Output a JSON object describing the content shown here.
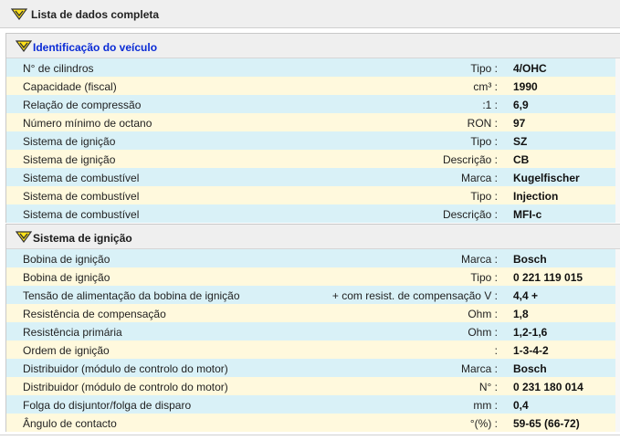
{
  "header": {
    "title": "Lista de dados completa",
    "icon": "chevron-down-icon"
  },
  "colors": {
    "row_alt_a": "#d9f1f7",
    "row_alt_b": "#fff9dd",
    "section_title_blue": "#0a2bd6",
    "icon_yellow": "#ffe21a"
  },
  "sections": [
    {
      "title": "Identificação do veículo",
      "rows": [
        {
          "label": "N° de cilindros",
          "unit": "Tipo :",
          "value": "4/OHC"
        },
        {
          "label": "Capacidade (fiscal)",
          "unit": "cm³ :",
          "value": "1990"
        },
        {
          "label": "Relação de compressão",
          "unit": ":1 :",
          "value": "6,9"
        },
        {
          "label": "Número mínimo de octano",
          "unit": "RON :",
          "value": "97"
        },
        {
          "label": "Sistema de ignição",
          "unit": "Tipo :",
          "value": "SZ"
        },
        {
          "label": "Sistema de ignição",
          "unit": "Descrição :",
          "value": "CB"
        },
        {
          "label": "Sistema de combustível",
          "unit": "Marca :",
          "value": "Kugelfischer"
        },
        {
          "label": "Sistema de combustível",
          "unit": "Tipo :",
          "value": "Injection"
        },
        {
          "label": "Sistema de combustível",
          "unit": "Descrição :",
          "value": "MFI-c"
        }
      ]
    },
    {
      "title": "Sistema de ignição",
      "rows": [
        {
          "label": "Bobina de ignição",
          "unit": "Marca :",
          "value": "Bosch"
        },
        {
          "label": "Bobina de ignição",
          "unit": "Tipo :",
          "value": "0 221 119 015"
        },
        {
          "label": "Tensão de alimentação da bobina de ignição",
          "unit": "+ com resist. de compensação  V :",
          "value": "4,4 +"
        },
        {
          "label": "Resistência de compensação",
          "unit": "Ohm :",
          "value": "1,8"
        },
        {
          "label": "Resistência primária",
          "unit": "Ohm :",
          "value": "1,2-1,6"
        },
        {
          "label": "Ordem de ignição",
          "unit": ":",
          "value": "1-3-4-2"
        },
        {
          "label": "Distribuidor (módulo de controlo do motor)",
          "unit": "Marca :",
          "value": "Bosch"
        },
        {
          "label": "Distribuidor (módulo de controlo do motor)",
          "unit": "N° :",
          "value": "0 231 180 014"
        },
        {
          "label": "Folga do disjuntor/folga de disparo",
          "unit": "mm :",
          "value": "0,4"
        },
        {
          "label": "Ângulo de contacto",
          "unit": "°(%) :",
          "value": "59-65 (66-72)"
        }
      ]
    }
  ]
}
